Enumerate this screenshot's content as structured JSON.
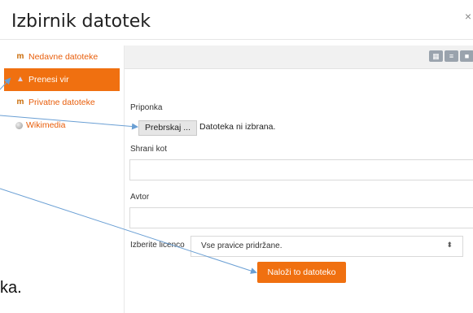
{
  "dialog": {
    "title": "Izbirnik datotek",
    "close_glyph": "×"
  },
  "sidebar": {
    "items": [
      {
        "label": "Nedavne datoteke",
        "icon": "folder-icon",
        "active": false
      },
      {
        "label": "Prenesi vir",
        "icon": "upload-icon",
        "active": true
      },
      {
        "label": "Privatne datoteke",
        "icon": "folder-icon",
        "active": false
      },
      {
        "label": "Wikimedia",
        "icon": "globe-icon",
        "active": false
      }
    ]
  },
  "toolbar": {
    "views": [
      "grid-view-icon",
      "list-view-icon",
      "tree-view-icon"
    ]
  },
  "form": {
    "attachment_label": "Priponka",
    "browse_label": "Prebrskaj ...",
    "file_status": "Datoteka ni izbrana.",
    "save_as_label": "Shrani kot",
    "save_as_value": "",
    "author_label": "Avtor",
    "author_value": "",
    "license_label": "Izberite licenco",
    "license_value": "Vse pravice pridržane.",
    "upload_label": "Naloži to datoteko"
  },
  "stray_text": "ka.",
  "colors": {
    "accent": "#f07010",
    "link": "#e85d0a",
    "arrow": "#6a9fd4"
  }
}
